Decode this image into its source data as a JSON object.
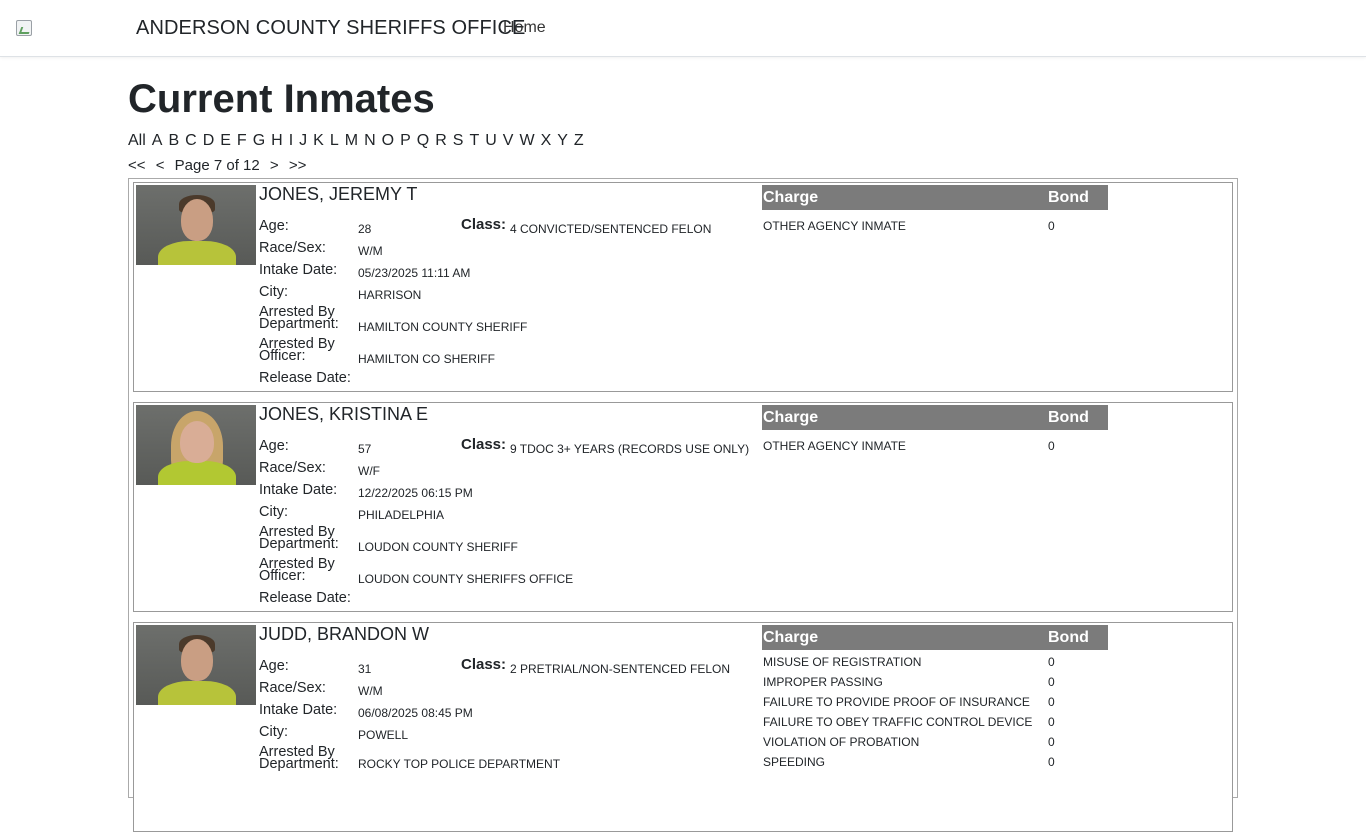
{
  "header": {
    "brand": "ANDERSON COUNTY SHERIFFS OFFICE",
    "nav_home": "Home"
  },
  "page_title": "Current Inmates",
  "alpha_nav": [
    "All",
    "A",
    "B",
    "C",
    "D",
    "E",
    "F",
    "G",
    "H",
    "I",
    "J",
    "K",
    "L",
    "M",
    "N",
    "O",
    "P",
    "Q",
    "R",
    "S",
    "T",
    "U",
    "V",
    "W",
    "X",
    "Y",
    "Z"
  ],
  "pager": {
    "first": "<<",
    "prev": "<",
    "text": "Page 7 of 12",
    "next": ">",
    "last": ">>"
  },
  "labels": {
    "age": "Age:",
    "race_sex": "Race/Sex:",
    "intake": "Intake Date:",
    "city": "City:",
    "arrested_dept_1": "Arrested By",
    "arrested_dept_2": "Department:",
    "arrested_off_1": "Arrested By",
    "arrested_off_2": "Officer:",
    "release": "Release Date:",
    "class": "Class:",
    "charge": "Charge",
    "bond": "Bond"
  },
  "inmates": [
    {
      "name": "JONES, JEREMY T",
      "age": "28",
      "class": "4 CONVICTED/SENTENCED FELON",
      "race_sex": "W/M",
      "intake": "05/23/2025 11:11 AM",
      "city": "HARRISON",
      "dept": "HAMILTON COUNTY SHERIFF",
      "officer": "HAMILTON CO SHERIFF",
      "charges": [
        {
          "charge": "OTHER AGENCY INMATE",
          "bond": "0"
        }
      ]
    },
    {
      "name": "JONES, KRISTINA E",
      "age": "57",
      "class": "9 TDOC 3+ YEARS (RECORDS USE ONLY)",
      "race_sex": "W/F",
      "intake": "12/22/2025 06:15 PM",
      "city": "PHILADELPHIA",
      "dept": "LOUDON COUNTY SHERIFF",
      "officer": "LOUDON COUNTY SHERIFFS OFFICE",
      "charges": [
        {
          "charge": "OTHER AGENCY INMATE",
          "bond": "0"
        }
      ]
    },
    {
      "name": "JUDD, BRANDON W",
      "age": "31",
      "class": "2 PRETRIAL/NON-SENTENCED FELON",
      "race_sex": "W/M",
      "intake": "06/08/2025 08:45 PM",
      "city": "POWELL",
      "dept": "ROCKY TOP POLICE DEPARTMENT",
      "charges": [
        {
          "charge": "MISUSE OF REGISTRATION",
          "bond": "0"
        },
        {
          "charge": "IMPROPER PASSING",
          "bond": "0"
        },
        {
          "charge": "FAILURE TO PROVIDE PROOF OF INSURANCE",
          "bond": "0"
        },
        {
          "charge": "FAILURE TO OBEY TRAFFIC CONTROL DEVICE",
          "bond": "0"
        },
        {
          "charge": "VIOLATION OF PROBATION",
          "bond": "0"
        },
        {
          "charge": "SPEEDING",
          "bond": "0"
        }
      ]
    }
  ]
}
